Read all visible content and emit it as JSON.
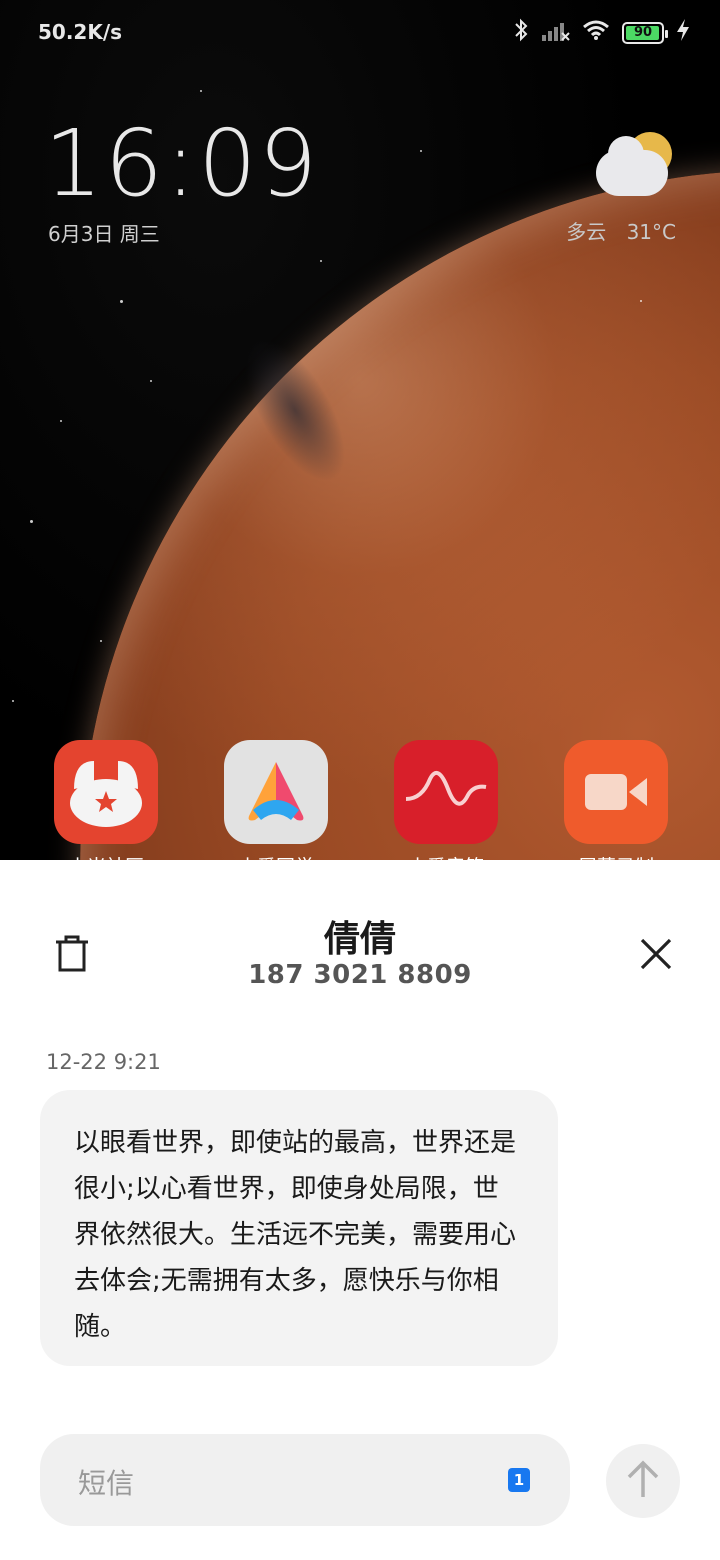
{
  "status_bar": {
    "net_speed": "50.2K/s",
    "battery_level": "90",
    "icons": [
      "bluetooth-icon",
      "signal-icon",
      "wifi-icon",
      "battery-icon",
      "charging-icon"
    ]
  },
  "lockscreen": {
    "time": "16:09",
    "date": "6月3日 周三",
    "weather": {
      "condition": "多云",
      "temperature": "31°C",
      "icon": "partly-cloudy-icon"
    }
  },
  "apps": [
    {
      "label": "小米社区",
      "icon": "mi-community-icon",
      "color": "#e4442f"
    },
    {
      "label": "小爱同学",
      "icon": "xiaoai-icon",
      "color": "#dcdcdc"
    },
    {
      "label": "小爱音箱",
      "icon": "xiaoai-speaker-icon",
      "color": "#d81f2a"
    },
    {
      "label": "屏幕录制",
      "icon": "screen-record-icon",
      "color": "#ef5b2c"
    }
  ],
  "message_sheet": {
    "contact_name": "倩倩",
    "contact_number": "187 3021 8809",
    "message_time": "12-22 9:21",
    "message_body": "以眼看世界，即使站的最高，世界还是很小;以心看世界，即使身处局限，世界依然很大。生活远不完美，需要用心去体会;无需拥有太多，愿快乐与你相随。",
    "input_placeholder": "短信",
    "sim_slot": "1"
  },
  "colors": {
    "sim_badge": "#1878f0",
    "battery": "#4cd964"
  }
}
